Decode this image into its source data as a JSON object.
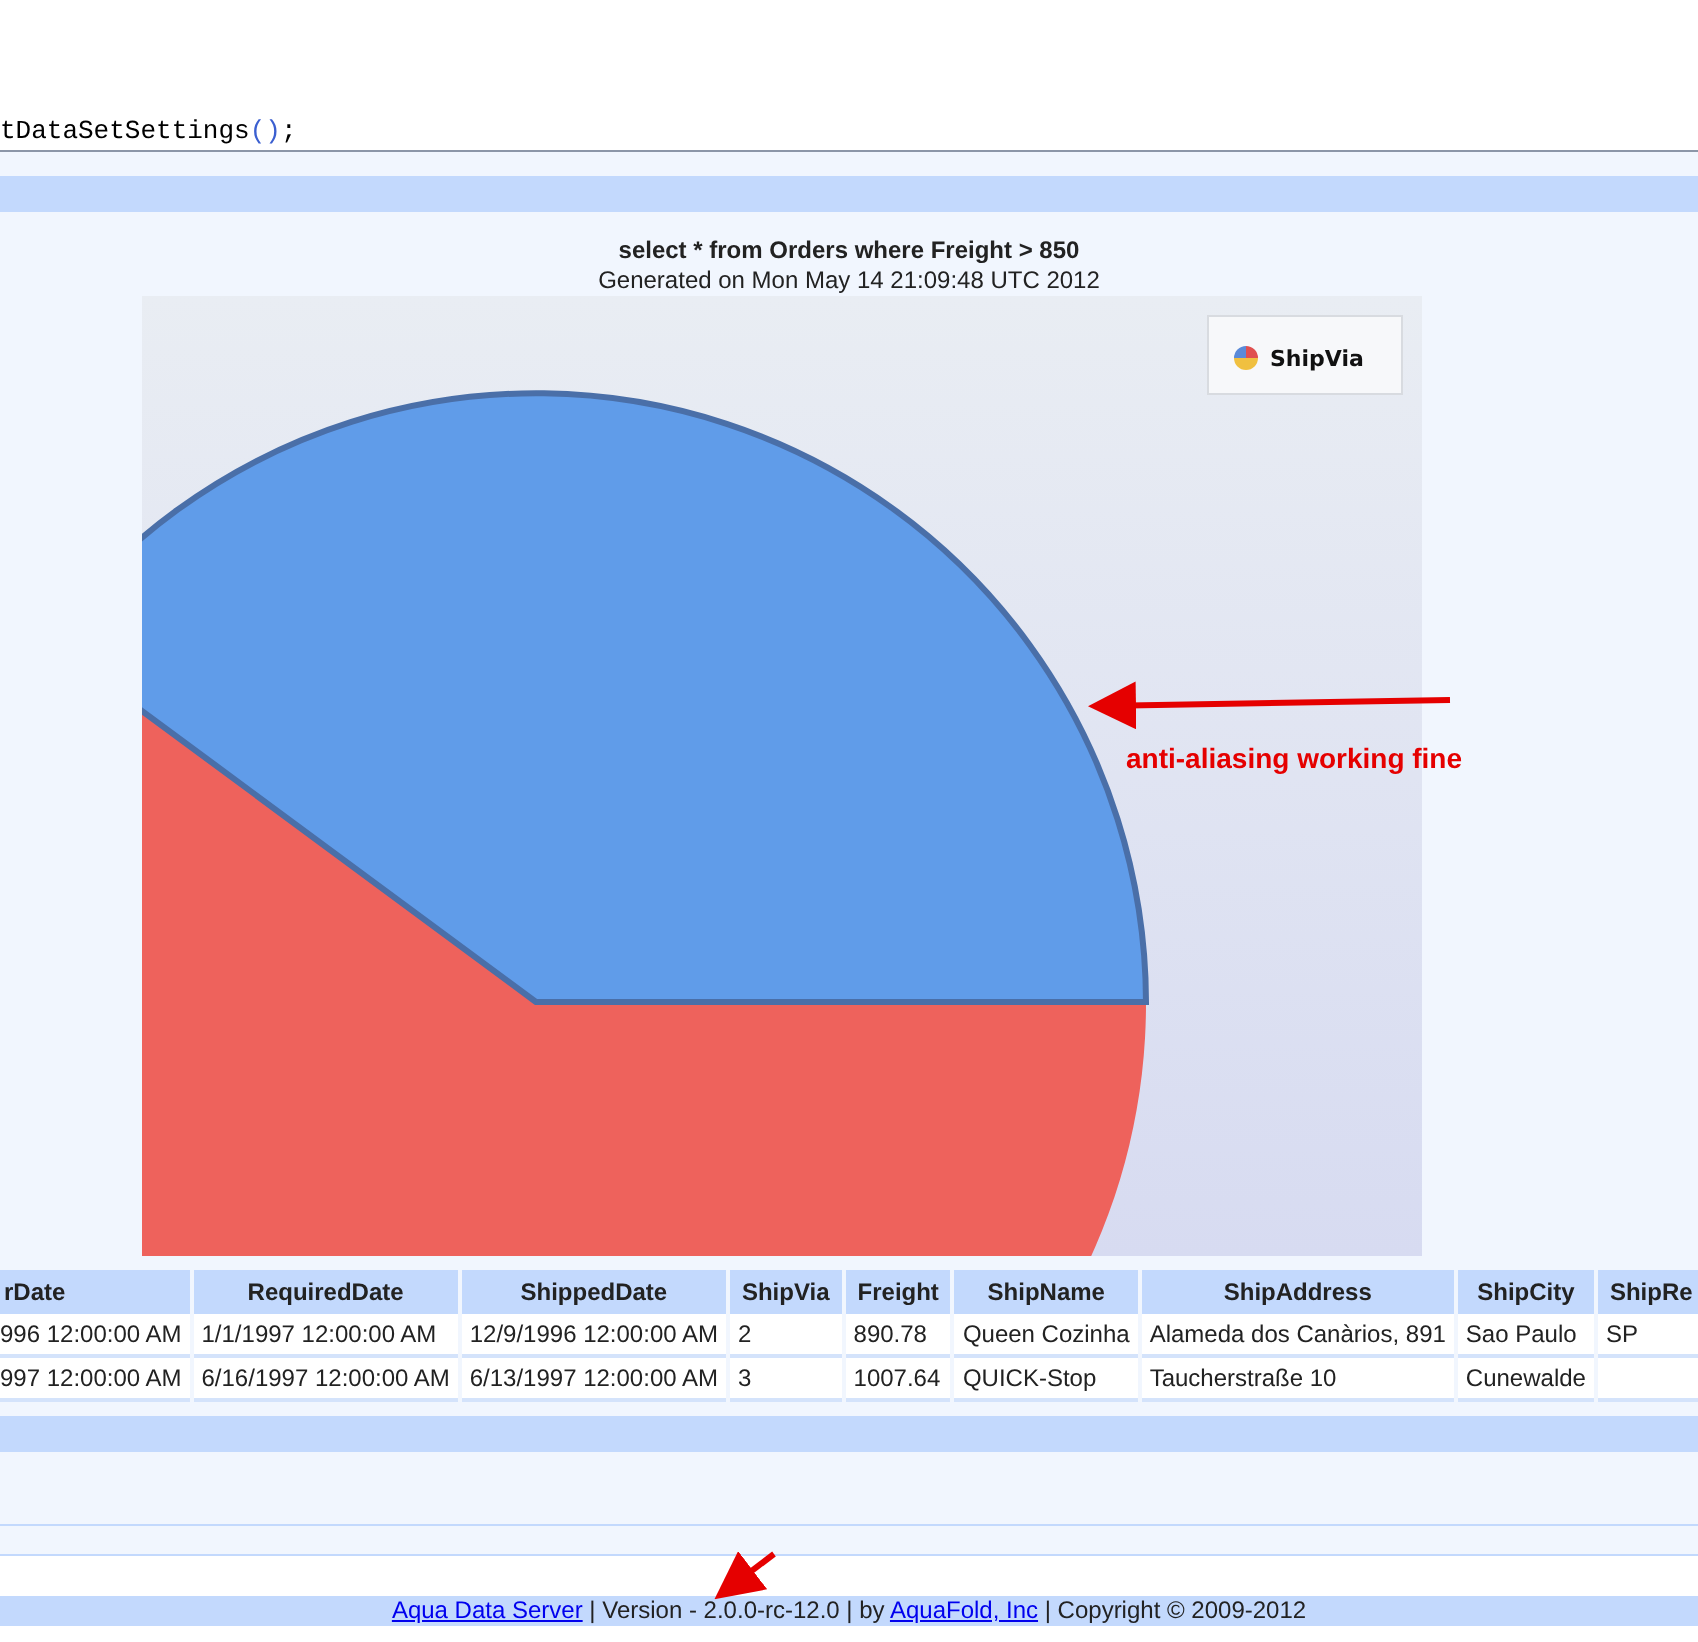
{
  "code_lines": [
    {
      "tokens": [
        {
          "text": "tDataSetSettings",
          "kind": "plain"
        },
        {
          "text": "()",
          "kind": "punct"
        },
        {
          "text": ";",
          "kind": "plain"
        }
      ]
    }
  ],
  "report": {
    "title": "select * from Orders where Freight > 850",
    "subtitle": "Generated on Mon May 14 21:09:48 UTC 2012",
    "chart": {
      "kind": "picture",
      "legend": {
        "label": "ShipVia"
      }
    },
    "annotation": "anti-aliasing working fine"
  },
  "table": {
    "columns": [
      "rDate",
      "RequiredDate",
      "ShippedDate",
      "ShipVia",
      "Freight",
      "ShipName",
      "ShipAddress",
      "ShipCity",
      "ShipRe"
    ],
    "rows": [
      [
        "996 12:00:00 AM",
        "1/1/1997 12:00:00 AM",
        "12/9/1996 12:00:00 AM",
        "2",
        "890.78",
        "Queen Cozinha",
        "Alameda dos Canàrios, 891",
        "Sao Paulo",
        "SP"
      ],
      [
        "997 12:00:00 AM",
        "6/16/1997 12:00:00 AM",
        "6/13/1997 12:00:00 AM",
        "3",
        "1007.64",
        "QUICK-Stop",
        "Taucherstraße 10",
        "Cunewalde",
        ""
      ]
    ]
  },
  "footer": [
    {
      "text": "Aqua Data Server",
      "kind": "link"
    },
    {
      "text": " | Version - 2.0.0-rc-12.0 | by ",
      "kind": "plain"
    },
    {
      "text": "AquaFold, Inc",
      "kind": "link"
    },
    {
      "text": " | Copyright © 2009-2012",
      "kind": "plain"
    }
  ]
}
